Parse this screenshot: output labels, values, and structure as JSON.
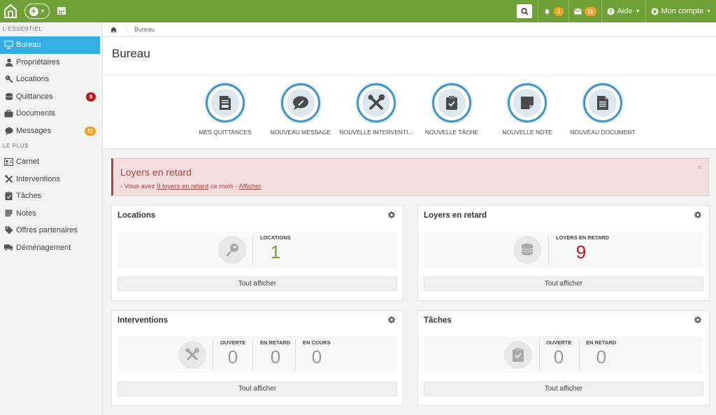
{
  "topbar": {
    "alerts_count": "1",
    "messages_count": "11",
    "help_label": "Aide",
    "account_label": "Mon compte"
  },
  "sidebar": {
    "section1": "L'ESSENTIEL",
    "section2": "LE PLUS",
    "items": [
      {
        "label": "Bureau",
        "icon": "monitor-icon"
      },
      {
        "label": "Propriétaires",
        "icon": "user-icon"
      },
      {
        "label": "Locations",
        "icon": "key-icon"
      },
      {
        "label": "Quittances",
        "icon": "coins-icon",
        "badge": "9"
      },
      {
        "label": "Documents",
        "icon": "briefcase-icon"
      },
      {
        "label": "Messages",
        "icon": "chat-icon",
        "badge": "11"
      },
      {
        "label": "Carnet",
        "icon": "contact-card-icon"
      },
      {
        "label": "Interventions",
        "icon": "tools-icon"
      },
      {
        "label": "Tâches",
        "icon": "checklist-icon"
      },
      {
        "label": "Notes",
        "icon": "note-icon"
      },
      {
        "label": "Offres partenaires",
        "icon": "tags-icon"
      },
      {
        "label": "Déménagement",
        "icon": "truck-icon"
      }
    ]
  },
  "breadcrumb": {
    "current": "Bureau"
  },
  "page": {
    "title": "Bureau"
  },
  "shortcuts": [
    {
      "label": "MES QUITTANCES",
      "icon": "receipt-icon"
    },
    {
      "label": "NOUVEAU MESSAGE",
      "icon": "chat-icon"
    },
    {
      "label": "NOUVELLE INTERVENTI...",
      "icon": "tools-icon"
    },
    {
      "label": "NOUVELLE TÂCHE",
      "icon": "checklist-icon"
    },
    {
      "label": "NOUVELLE NOTE",
      "icon": "note-icon"
    },
    {
      "label": "NOUVEAU DOCUMENT",
      "icon": "document-icon"
    }
  ],
  "alert": {
    "title": "Loyers en retard",
    "prefix": "- Vous avez ",
    "link_text": "9 loyers en retard",
    "suffix": " ce mois - ",
    "action": "Afficher",
    "close": "×"
  },
  "panels": {
    "locations": {
      "title": "Locations",
      "stat_label": "LOCATIONS",
      "stat_value": "1",
      "button": "Tout afficher"
    },
    "loyers": {
      "title": "Loyers en retard",
      "stat_label": "LOYERS EN RETARD",
      "stat_value": "9",
      "button": "Tout afficher"
    },
    "interventions": {
      "title": "Interventions",
      "stats": [
        {
          "label": "OUVERTE",
          "value": "0"
        },
        {
          "label": "EN RETARD",
          "value": "0"
        },
        {
          "label": "EN COURS",
          "value": "0"
        }
      ],
      "button": "Tout afficher"
    },
    "taches": {
      "title": "Tâches",
      "stats": [
        {
          "label": "OUVERTE",
          "value": "0"
        },
        {
          "label": "EN RETARD",
          "value": "0"
        }
      ],
      "button": "Tout afficher"
    }
  },
  "colors": {
    "brand_green": "#6fa136",
    "active_blue": "#35aee4",
    "alert_red": "#a94442",
    "badge_orange": "#f0a31c",
    "badge_red": "#c0151b"
  }
}
